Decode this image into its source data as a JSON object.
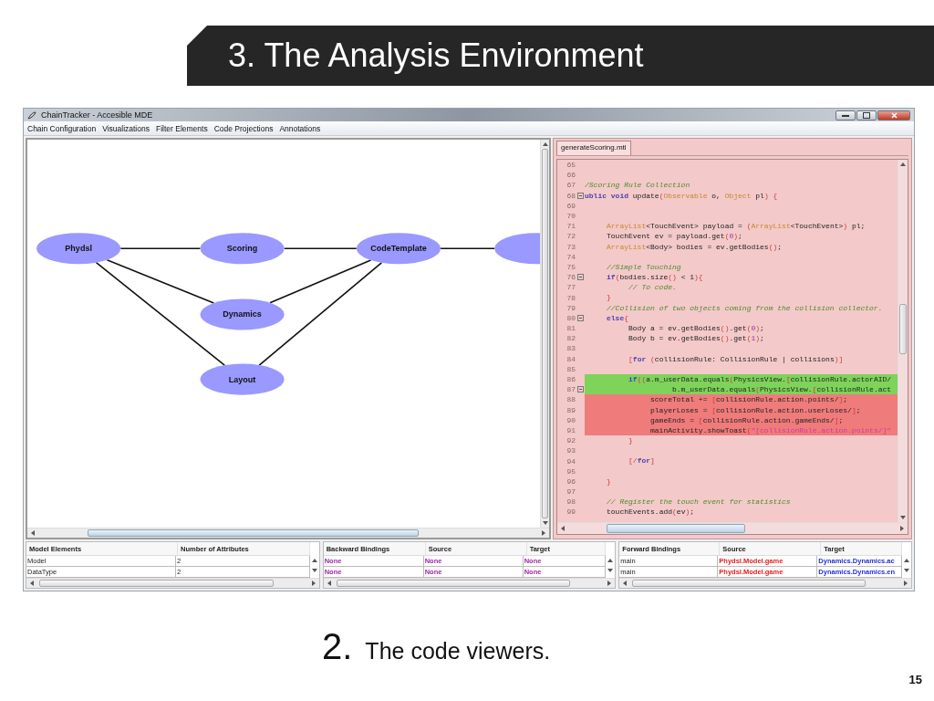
{
  "slide_title": "3. The Analysis Environment",
  "window": {
    "title": "ChainTracker - Accesible MDE"
  },
  "menu": [
    "Chain Configuration",
    "Visualizations",
    "Filter Elements",
    "Code Projections",
    "Annotations"
  ],
  "graph": {
    "nodes": [
      {
        "label": "Phydsl"
      },
      {
        "label": "Scoring"
      },
      {
        "label": "CodeTemplate"
      },
      {
        "label": "Dynamics"
      },
      {
        "label": "Layout"
      }
    ]
  },
  "code": {
    "tab": {
      "label": "generateScoring.mtl",
      "selected": true
    },
    "lines": [
      {
        "n": "65",
        "fold": false
      },
      {
        "n": "66",
        "fold": false
      },
      {
        "n": "67",
        "fold": false,
        "tokens": [
          {
            "kind": "comment",
            "text": "/Scoring Rule Collection"
          }
        ]
      },
      {
        "n": "68",
        "fold": true,
        "tokens": [
          {
            "kind": "kw",
            "text": "ublic void"
          },
          {
            "kind": "plain",
            "text": " update"
          },
          {
            "kind": "tpl",
            "text": "("
          },
          {
            "kind": "type",
            "text": "Observable"
          },
          {
            "kind": "plain",
            "text": " o, "
          },
          {
            "kind": "type",
            "text": "Object"
          },
          {
            "kind": "plain",
            "text": " pl"
          },
          {
            "kind": "tpl",
            "text": ") {"
          }
        ]
      },
      {
        "n": "69",
        "fold": false
      },
      {
        "n": "70",
        "fold": false
      },
      {
        "n": "71",
        "fold": false,
        "tokens": [
          {
            "kind": "type",
            "text": "\tArrayList"
          },
          {
            "kind": "plain",
            "text": "<TouchEvent> payload = "
          },
          {
            "kind": "tpl",
            "text": "("
          },
          {
            "kind": "type",
            "text": "ArrayList"
          },
          {
            "kind": "plain",
            "text": "<TouchEvent>"
          },
          {
            "kind": "tpl",
            "text": ")"
          },
          {
            "kind": "plain",
            "text": " pl;"
          }
        ]
      },
      {
        "n": "72",
        "fold": false,
        "tokens": [
          {
            "kind": "plain",
            "text": "\tTouchEvent ev = payload.get"
          },
          {
            "kind": "tpl",
            "text": "("
          },
          {
            "kind": "num",
            "text": "0"
          },
          {
            "kind": "tpl",
            "text": ")"
          },
          {
            "kind": "plain",
            "text": ";"
          }
        ]
      },
      {
        "n": "73",
        "fold": false,
        "tokens": [
          {
            "kind": "type",
            "text": "\tArrayList"
          },
          {
            "kind": "plain",
            "text": "<Body> bodies = ev.getBodies"
          },
          {
            "kind": "tpl",
            "text": "()"
          },
          {
            "kind": "plain",
            "text": ";"
          }
        ]
      },
      {
        "n": "74",
        "fold": false
      },
      {
        "n": "75",
        "fold": false,
        "tokens": [
          {
            "kind": "comment",
            "text": "\t//Simple Touching"
          }
        ]
      },
      {
        "n": "76",
        "fold": true,
        "tokens": [
          {
            "kind": "kw",
            "text": "\tif"
          },
          {
            "kind": "tpl",
            "text": "("
          },
          {
            "kind": "plain",
            "text": "bodies.size"
          },
          {
            "kind": "tpl",
            "text": "()"
          },
          {
            "kind": "plain",
            "text": " < 1"
          },
          {
            "kind": "tpl",
            "text": "){"
          }
        ]
      },
      {
        "n": "77",
        "fold": false,
        "tokens": [
          {
            "kind": "comment",
            "text": "\t\t// To code."
          }
        ]
      },
      {
        "n": "78",
        "fold": false,
        "tokens": [
          {
            "kind": "tpl",
            "text": "\t}"
          }
        ]
      },
      {
        "n": "79",
        "fold": false,
        "tokens": [
          {
            "kind": "comment",
            "text": "\t//Collision of two objects coming from the collision collector."
          }
        ]
      },
      {
        "n": "80",
        "fold": true,
        "tokens": [
          {
            "kind": "kw",
            "text": "\telse"
          },
          {
            "kind": "tpl",
            "text": "{"
          }
        ]
      },
      {
        "n": "81",
        "fold": false,
        "tokens": [
          {
            "kind": "plain",
            "text": "\t\tBody a = ev.getBodies"
          },
          {
            "kind": "tpl",
            "text": "()"
          },
          {
            "kind": "plain",
            "text": ".get"
          },
          {
            "kind": "tpl",
            "text": "("
          },
          {
            "kind": "num",
            "text": "0"
          },
          {
            "kind": "tpl",
            "text": ")"
          },
          {
            "kind": "plain",
            "text": ";"
          }
        ]
      },
      {
        "n": "82",
        "fold": false,
        "tokens": [
          {
            "kind": "plain",
            "text": "\t\tBody b = ev.getBodies"
          },
          {
            "kind": "tpl",
            "text": "()"
          },
          {
            "kind": "plain",
            "text": ".get"
          },
          {
            "kind": "tpl",
            "text": "("
          },
          {
            "kind": "num",
            "text": "1"
          },
          {
            "kind": "tpl",
            "text": ")"
          },
          {
            "kind": "plain",
            "text": ";"
          }
        ]
      },
      {
        "n": "83",
        "fold": false
      },
      {
        "n": "84",
        "fold": false,
        "tokens": [
          {
            "kind": "tpl",
            "text": "\t\t["
          },
          {
            "kind": "kw",
            "text": "for"
          },
          {
            "kind": "tpl",
            "text": " ("
          },
          {
            "kind": "plain",
            "text": "collisionRule: CollisionRule | collisions"
          },
          {
            "kind": "tpl",
            "text": ")]"
          }
        ]
      },
      {
        "n": "85",
        "fold": false
      },
      {
        "n": "86",
        "fold": false,
        "color": "#7ed35a",
        "tokens": [
          {
            "kind": "kw",
            "text": "\t\tif"
          },
          {
            "kind": "tpl",
            "text": "(("
          },
          {
            "kind": "plain",
            "text": "a.m_userData.equals"
          },
          {
            "kind": "tpl",
            "text": "("
          },
          {
            "kind": "plain",
            "text": "PhysicsView."
          },
          {
            "kind": "tpl",
            "text": "["
          },
          {
            "kind": "plain",
            "text": "collisionRule.actorAID/"
          }
        ]
      },
      {
        "n": "87",
        "fold": true,
        "color": "#7ed35a",
        "tokens": [
          {
            "kind": "plain",
            "text": "\t\t\t\tb.m_userData.equals"
          },
          {
            "kind": "tpl",
            "text": "("
          },
          {
            "kind": "plain",
            "text": "PhysicsView."
          },
          {
            "kind": "tpl",
            "text": "["
          },
          {
            "kind": "plain",
            "text": "collisionRule.act"
          }
        ]
      },
      {
        "n": "88",
        "fold": false,
        "color": "#f07b7b",
        "tokens": [
          {
            "kind": "plain",
            "text": "\t\t\tscoreTotal += "
          },
          {
            "kind": "tpl",
            "text": "["
          },
          {
            "kind": "plain",
            "text": "collisionRule.action.points/"
          },
          {
            "kind": "tpl",
            "text": "]"
          },
          {
            "kind": "plain",
            "text": ";"
          }
        ]
      },
      {
        "n": "89",
        "fold": false,
        "color": "#f07b7b",
        "tokens": [
          {
            "kind": "plain",
            "text": "\t\t\tplayerLoses = "
          },
          {
            "kind": "tpl",
            "text": "["
          },
          {
            "kind": "plain",
            "text": "collisionRule.action.userLoses/"
          },
          {
            "kind": "tpl",
            "text": "]"
          },
          {
            "kind": "plain",
            "text": ";"
          }
        ]
      },
      {
        "n": "90",
        "fold": false,
        "color": "#f07b7b",
        "tokens": [
          {
            "kind": "plain",
            "text": "\t\t\tgameEnds = "
          },
          {
            "kind": "tpl",
            "text": "["
          },
          {
            "kind": "plain",
            "text": "collisionRule.action.gameEnds/"
          },
          {
            "kind": "tpl",
            "text": "]"
          },
          {
            "kind": "plain",
            "text": ";"
          }
        ]
      },
      {
        "n": "91",
        "fold": false,
        "color": "#f07b7b",
        "tokens": [
          {
            "kind": "plain",
            "text": "\t\t\tmainActivity.showToast"
          },
          {
            "kind": "tpl",
            "text": "("
          },
          {
            "kind": "str",
            "text": "\"[collisionRule.action.points/]\""
          }
        ]
      },
      {
        "n": "92",
        "fold": false,
        "tokens": [
          {
            "kind": "tpl",
            "text": "\t\t}"
          }
        ]
      },
      {
        "n": "93",
        "fold": false
      },
      {
        "n": "94",
        "fold": false,
        "tokens": [
          {
            "kind": "tpl",
            "text": "\t\t[/"
          },
          {
            "kind": "kw",
            "text": "for"
          },
          {
            "kind": "tpl",
            "text": "]"
          }
        ]
      },
      {
        "n": "95",
        "fold": false
      },
      {
        "n": "96",
        "fold": false,
        "tokens": [
          {
            "kind": "tpl",
            "text": "\t}"
          }
        ]
      },
      {
        "n": "97",
        "fold": false
      },
      {
        "n": "98",
        "fold": false,
        "tokens": [
          {
            "kind": "comment",
            "text": "\t// Register the touch event for statistics"
          }
        ]
      },
      {
        "n": "99",
        "fold": false,
        "tokens": [
          {
            "kind": "plain",
            "text": "\ttouchEvents.add"
          },
          {
            "kind": "tpl",
            "text": "("
          },
          {
            "kind": "plain",
            "text": "ev"
          },
          {
            "kind": "tpl",
            "text": ")"
          },
          {
            "kind": "plain",
            "text": ";"
          }
        ]
      }
    ]
  },
  "tables": [
    {
      "columns": [
        "Model Elements",
        "Number of Attributes"
      ],
      "rows": [
        [
          {
            "text": "Model",
            "kind": "plain"
          },
          {
            "text": "2",
            "kind": "plain"
          }
        ],
        [
          {
            "text": "DataType",
            "kind": "plain"
          },
          {
            "text": "2",
            "kind": "plain"
          }
        ]
      ]
    },
    {
      "columns": [
        "Backward Bindings",
        "Source",
        "Target"
      ],
      "rows": [
        [
          {
            "text": "None",
            "kind": "missing"
          },
          {
            "text": "None",
            "kind": "missing"
          },
          {
            "text": "None",
            "kind": "missing"
          }
        ],
        [
          {
            "text": "None",
            "kind": "missing"
          },
          {
            "text": "None",
            "kind": "missing"
          },
          {
            "text": "None",
            "kind": "missing"
          }
        ]
      ]
    },
    {
      "columns": [
        "Forward Bindings",
        "Source",
        "Target"
      ],
      "rows": [
        [
          {
            "text": "main",
            "kind": "plain"
          },
          {
            "text": "Phydsl.Model.game",
            "kind": "source"
          },
          {
            "text": "Dynamics.Dynamics.ac",
            "kind": "target"
          }
        ],
        [
          {
            "text": "main",
            "kind": "plain"
          },
          {
            "text": "Phydsl.Model.game",
            "kind": "source"
          },
          {
            "text": "Dynamics.Dynamics.en",
            "kind": "target"
          }
        ]
      ]
    }
  ],
  "caption": {
    "number": "2.",
    "text": "The code viewers."
  },
  "page_number": "15"
}
